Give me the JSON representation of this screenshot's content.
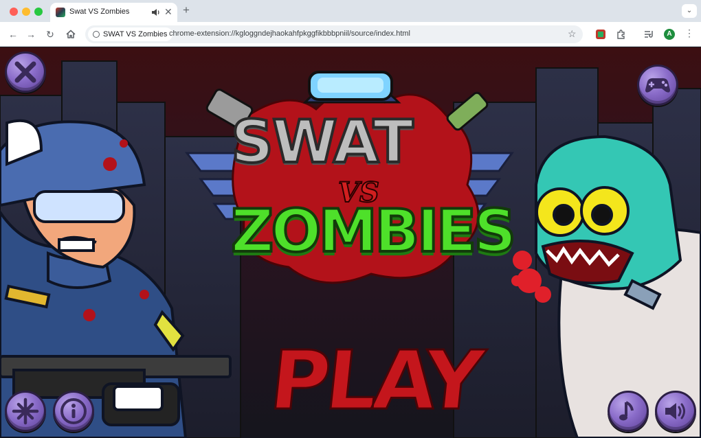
{
  "browser": {
    "tab_title": "Swat VS Zombies",
    "site_chip": "SWAT VS Zombies",
    "url": "chrome-extension://kgloggndejhaokahfpkggfikbbbpniil/source/index.html",
    "profile_initial": "A",
    "icons": {
      "back": "arrow-left-icon",
      "forward": "arrow-right-icon",
      "reload": "reload-icon",
      "home": "home-icon",
      "bookmark": "star-icon",
      "extensions": "puzzle-icon",
      "media": "media-controls-icon",
      "menu": "kebab-menu-icon"
    }
  },
  "game": {
    "title_line1": "SWAT",
    "title_vs": "VS",
    "title_line2": "ZOMBIES",
    "play_label": "PLAY",
    "buttons": {
      "top_left": "close-icon",
      "top_right": "gamepad-icon",
      "bottom_left_1": "crosshair-icon",
      "bottom_left_2": "info-icon",
      "bottom_right_1": "music-note-icon",
      "bottom_right_2": "speaker-icon"
    },
    "colors": {
      "title_gray": "#bdbdbd",
      "title_green": "#4ee02a",
      "play_red": "#c4161c",
      "button_purple": "#8a6cc9",
      "blood_red": "#b3121a"
    }
  }
}
